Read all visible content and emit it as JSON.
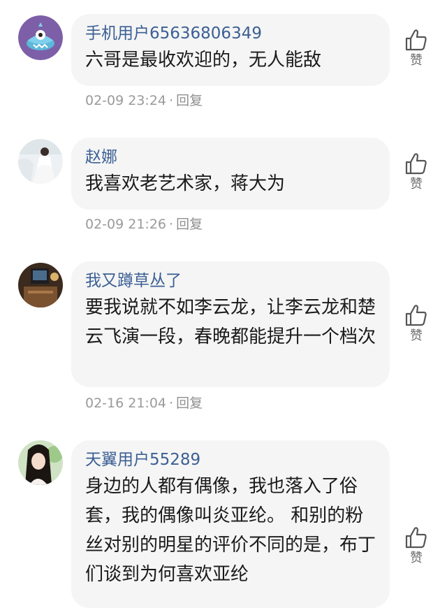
{
  "comments": [
    {
      "username": "手机用户65636806349",
      "text": "六哥是最收欢迎的，无人能敌",
      "time": "02-09 23:24",
      "separator": "·",
      "reply_label": "回复",
      "like_label": "赞"
    },
    {
      "username": "赵娜",
      "text": "我喜欢老艺术家，蒋大为",
      "time": "02-09 21:26",
      "separator": "·",
      "reply_label": "回复",
      "like_label": "赞"
    },
    {
      "username": "我又蹲草丛了",
      "text": "要我说就不如李云龙，让李云龙和楚云飞演一段，春晚都能提升一个档次",
      "time": "02-16 21:04",
      "separator": "·",
      "reply_label": "回复",
      "like_label": "赞"
    },
    {
      "username": "天翼用户55289",
      "text": "身边的人都有偶像，我也落入了俗套，我的偶像叫炎亚纶。 和别的粉丝对别的明星的评价不同的是，布丁们谈到为何喜欢亚纶",
      "like_label": "赞"
    }
  ],
  "colors": {
    "username": "#3b5f94",
    "bubble_bg": "#f5f5f5",
    "meta_text": "#9a9a9a",
    "body_text": "#1a1a1a"
  },
  "icons": {
    "like": "thumbs-up-icon"
  }
}
